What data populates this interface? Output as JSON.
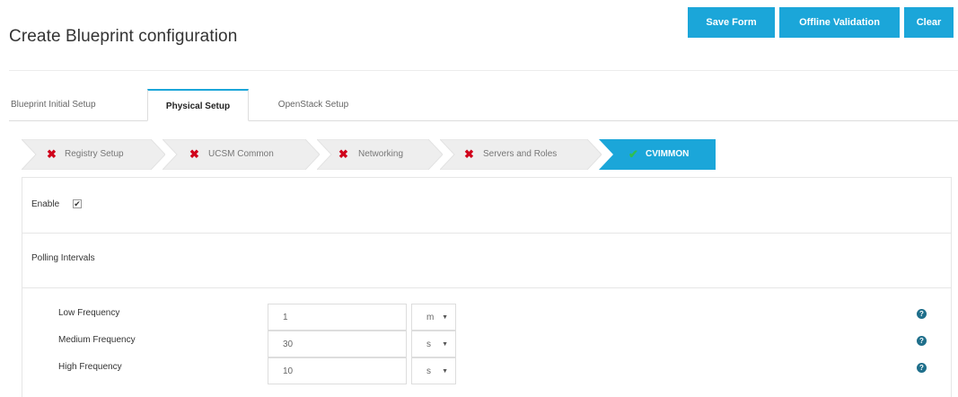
{
  "page": {
    "title": "Create Blueprint configuration"
  },
  "actions": {
    "save": "Save Form",
    "offline": "Offline Validation",
    "clear": "Clear"
  },
  "tabs": [
    {
      "label": "Blueprint Initial Setup",
      "active": false
    },
    {
      "label": "Physical Setup",
      "active": true
    },
    {
      "label": "OpenStack Setup",
      "active": false
    }
  ],
  "wizard": {
    "steps": [
      {
        "label": "Registry Setup",
        "status": "error"
      },
      {
        "label": "UCSM Common",
        "status": "error"
      },
      {
        "label": "Networking",
        "status": "error"
      },
      {
        "label": "Servers and Roles",
        "status": "error"
      },
      {
        "label": "CVIMMON",
        "status": "done"
      }
    ],
    "error_icon": "✖",
    "done_icon": "✔",
    "colors": {
      "error": "#d0021b",
      "done_icon": "#2fbf4f",
      "done_bg": "#1ba6d9",
      "step_bg": "#eeeeee"
    }
  },
  "form": {
    "enable_label": "Enable",
    "enable_checked": true,
    "enable_mark": "✔",
    "polling_label": "Polling Intervals",
    "frequencies": [
      {
        "label": "Low Frequency",
        "value": "1",
        "unit": "m"
      },
      {
        "label": "Medium Frequency",
        "value": "30",
        "unit": "s"
      },
      {
        "label": "High Frequency",
        "value": "10",
        "unit": "s"
      }
    ],
    "caret": "▼",
    "help_glyph": "?"
  },
  "colors": {
    "accent": "#1ba6d9",
    "help": "#1f6f8b"
  }
}
